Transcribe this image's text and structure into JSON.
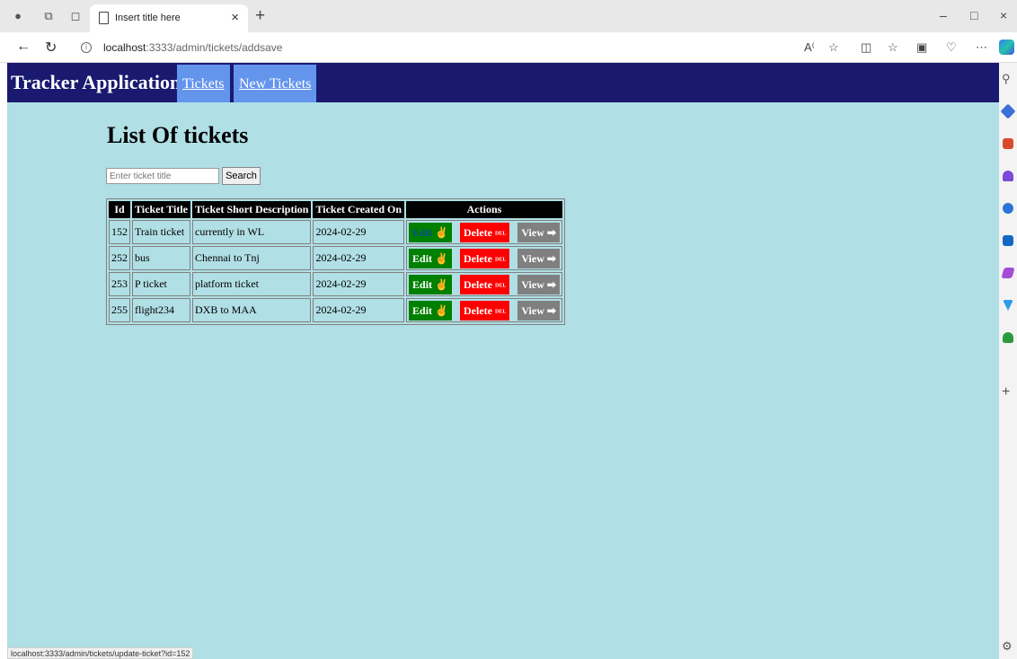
{
  "browser": {
    "tab_title": "Insert title here",
    "url_host": "localhost",
    "url_rest": ":3333/admin/tickets/addsave",
    "status_url": "localhost:3333/admin/tickets/update-ticket?id=152"
  },
  "app": {
    "brand": "Tracker Application",
    "nav": [
      "Tickets",
      "New Tickets"
    ]
  },
  "main": {
    "heading": "List Of tickets",
    "search_placeholder": "Enter ticket title",
    "search_button": "Search"
  },
  "table": {
    "headers": [
      "Id",
      "Ticket Title",
      "Ticket Short Description",
      "Ticket Created On",
      "Actions"
    ],
    "rows": [
      {
        "id": "152",
        "title": "Train ticket",
        "description": "currently in WL",
        "created": "2024-02-29"
      },
      {
        "id": "252",
        "title": "bus",
        "description": "Chennai to Tnj",
        "created": "2024-02-29"
      },
      {
        "id": "253",
        "title": "P ticket",
        "description": "platform ticket",
        "created": "2024-02-29"
      },
      {
        "id": "255",
        "title": "flight234",
        "description": "DXB to MAA",
        "created": "2024-02-29"
      }
    ],
    "actions": {
      "edit": "Edit",
      "delete": "Delete",
      "delete_badge": "DEL",
      "view": "View"
    }
  },
  "colors": {
    "page_bg": "#b0dfe5",
    "navbar": "#191970",
    "nav_link": "#6495ed",
    "edit": "#008000",
    "delete": "#ff0000",
    "view": "#808080"
  }
}
